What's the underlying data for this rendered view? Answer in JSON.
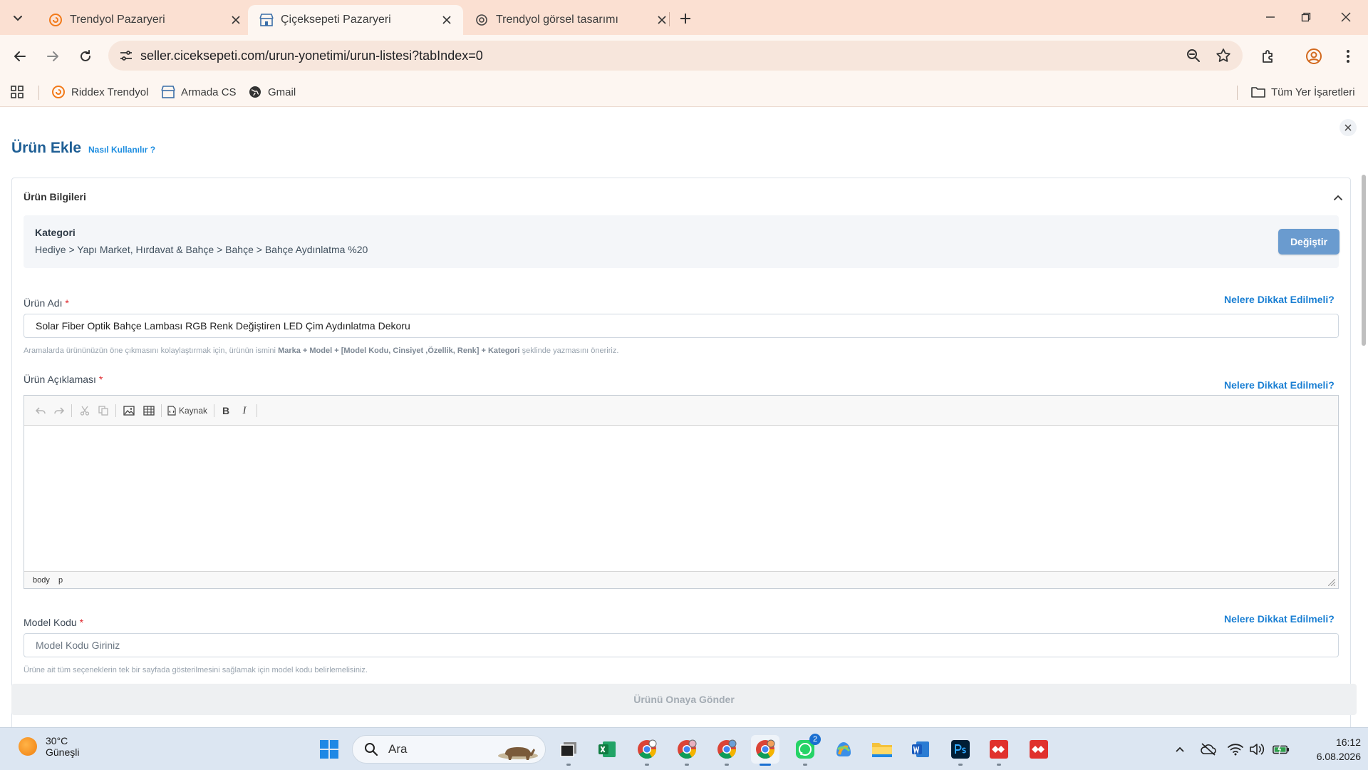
{
  "browser": {
    "tabs": [
      {
        "title": "Trendyol Pazaryeri",
        "active": false
      },
      {
        "title": "Çiçeksepeti Pazaryeri",
        "active": true
      },
      {
        "title": "Trendyol görsel tasarımı",
        "active": false
      }
    ],
    "url": "seller.ciceksepeti.com/urun-yonetimi/urun-listesi?tabIndex=0",
    "bookmarks": [
      {
        "label": "Riddex Trendyol",
        "icon": "trendyol-icon"
      },
      {
        "label": "Armada CS",
        "icon": "store-icon"
      },
      {
        "label": "Gmail",
        "icon": "globe-icon"
      }
    ],
    "all_bookmarks_label": "Tüm Yer İşaretleri"
  },
  "page": {
    "title": "Ürün Ekle",
    "how_to_link": "Nasıl Kullanılır ?",
    "section_title": "Ürün Bilgileri",
    "category": {
      "label": "Kategori",
      "path": "Hediye > Yapı Market, Hırdavat & Bahçe > Bahçe > Bahçe Aydınlatma %20",
      "change_button": "Değiştir"
    },
    "product_name": {
      "label": "Ürün Adı",
      "required_mark": "*",
      "hint_link": "Nelere Dikkat Edilmeli?",
      "value": "Solar Fiber Optik Bahçe Lambası RGB Renk Değiştiren LED Çim Aydınlatma Dekoru",
      "help_prefix": "Aramalarda ürününüzün öne çıkmasını kolaylaştırmak için, ürünün ismini",
      "help_bold": "Marka + Model + [Model Kodu, Cinsiyet ,Özellik, Renk] + Kategori",
      "help_suffix": "şeklinde yazmasını öneririz."
    },
    "description": {
      "label": "Ürün Açıklaması",
      "required_mark": "*",
      "hint_link": "Nelere Dikkat Edilmeli?",
      "toolbar_source_label": "Kaynak",
      "status_path": [
        "body",
        "p"
      ]
    },
    "model_code": {
      "label": "Model Kodu",
      "required_mark": "*",
      "hint_link": "Nelere Dikkat Edilmeli?",
      "placeholder": "Model Kodu Giriniz",
      "help": "Ürüne ait tüm seçeneklerin tek bir sayfada gösterilmesini sağlamak için model kodu belirlemelisiniz."
    },
    "submit_button": "Ürünü Onaya Gönder"
  },
  "taskbar": {
    "weather_temp": "30°C",
    "weather_condition": "Güneşli",
    "search_label": "Ara",
    "whatsapp_badge": "2",
    "time": "16:12",
    "date": "6.08.2026"
  },
  "colors": {
    "tab_strip": "#fbe0d2",
    "title_blue": "#1f5f95",
    "link_blue": "#1a7fd3",
    "button_blue": "#6a9bcf",
    "required_red": "#e0282e"
  }
}
